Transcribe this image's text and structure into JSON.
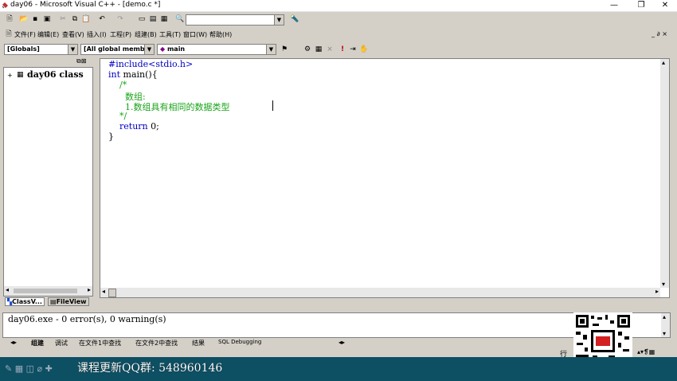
{
  "window": {
    "title": "day06 - Microsoft Visual C++ - [demo.c *]",
    "minimize_glyph": "—",
    "restore_glyph": "❐",
    "close_glyph": "✕"
  },
  "toolbar": {
    "find_combo_value": "",
    "combo_arrow": "▼"
  },
  "menu": {
    "items": [
      "文件(F)",
      "编辑(E)",
      "查看(V)",
      "插入(I)",
      "工程(P)",
      "组建(B)",
      "工具(T)",
      "窗口(W)",
      "帮助(H)"
    ],
    "mdi_buttons": "_ ∂ ×"
  },
  "wizardbar": {
    "scope": "[Globals]",
    "members": "[All global members",
    "function": "main"
  },
  "classview": {
    "root_label": "day06 class",
    "expand_glyph": "+",
    "tabs": [
      "ClassV...",
      "FileView"
    ]
  },
  "editor": {
    "lines": [
      {
        "text": "#include<stdio.h>",
        "kind": "kw"
      },
      {
        "text": "int main(){",
        "kind": "mixed_int"
      },
      {
        "text": "    /*",
        "kind": "cm"
      },
      {
        "text": "      数组:",
        "kind": "cm"
      },
      {
        "text": "      1.数组具有相同的数据类型",
        "kind": "cm"
      },
      {
        "text": "    */",
        "kind": "cm"
      },
      {
        "text": "    return 0;",
        "kind": "mixed_return"
      },
      {
        "text": "}",
        "kind": "plain"
      }
    ],
    "int_keyword": "int",
    "int_rest": " main(){",
    "return_keyword": "return",
    "return_rest": " 0;"
  },
  "output": {
    "message": "day06.exe - 0 error(s), 0 warning(s)",
    "tabs": [
      "组建",
      "调试",
      "在文件1中查找",
      "在文件2中查找",
      "结果",
      "SQL Debugging"
    ]
  },
  "status": {
    "line_label": "行"
  },
  "banner": {
    "text": "课程更新QQ群: 548960146"
  },
  "colors": {
    "keyword": "#0000c0",
    "comment": "#1aa31a",
    "banner_bg": "#0d4f63"
  }
}
